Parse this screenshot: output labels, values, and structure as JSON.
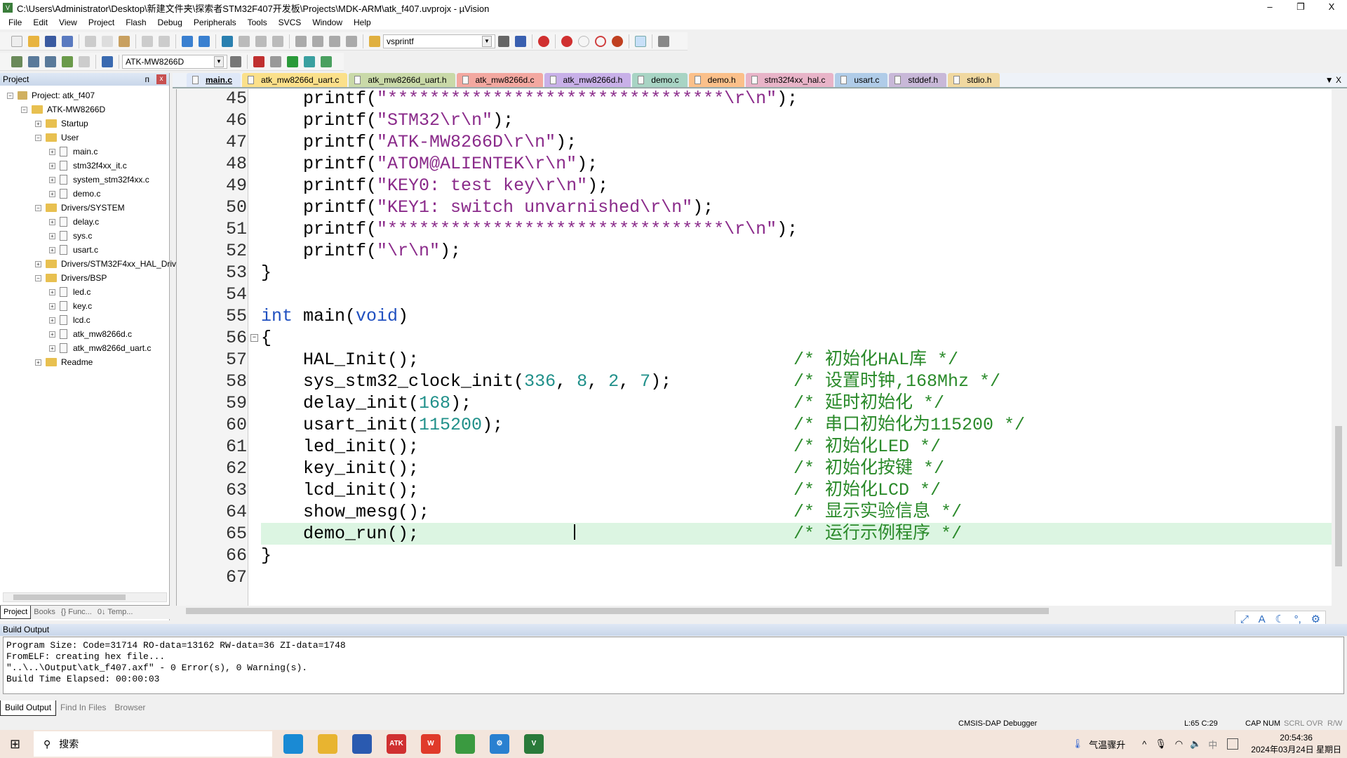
{
  "window": {
    "title": "C:\\Users\\Administrator\\Desktop\\新建文件夹\\探索者STM32F407开发板\\Projects\\MDK-ARM\\atk_f407.uvprojx - µVision",
    "minimize": "–",
    "restore": "❐",
    "close": "X"
  },
  "menu": [
    "File",
    "Edit",
    "View",
    "Project",
    "Flash",
    "Debug",
    "Peripherals",
    "Tools",
    "SVCS",
    "Window",
    "Help"
  ],
  "toolbar": {
    "find_combo": "vsprintf",
    "target_combo": "ATK-MW8266D"
  },
  "project_panel": {
    "title": "Project",
    "pin": "ᴨ",
    "close": "x",
    "tree": [
      {
        "label": "Project: atk_f407",
        "level": 0,
        "type": "root",
        "exp": "−"
      },
      {
        "label": "ATK-MW8266D",
        "level": 1,
        "type": "folder",
        "exp": "−"
      },
      {
        "label": "Startup",
        "level": 2,
        "type": "folder",
        "exp": "+"
      },
      {
        "label": "User",
        "level": 2,
        "type": "folder",
        "exp": "−"
      },
      {
        "label": "main.c",
        "level": 3,
        "type": "file",
        "exp": "+"
      },
      {
        "label": "stm32f4xx_it.c",
        "level": 3,
        "type": "file",
        "exp": "+"
      },
      {
        "label": "system_stm32f4xx.c",
        "level": 3,
        "type": "file",
        "exp": "+"
      },
      {
        "label": "demo.c",
        "level": 3,
        "type": "file",
        "exp": "+"
      },
      {
        "label": "Drivers/SYSTEM",
        "level": 2,
        "type": "folder",
        "exp": "−"
      },
      {
        "label": "delay.c",
        "level": 3,
        "type": "file",
        "exp": "+"
      },
      {
        "label": "sys.c",
        "level": 3,
        "type": "file",
        "exp": "+"
      },
      {
        "label": "usart.c",
        "level": 3,
        "type": "file",
        "exp": "+"
      },
      {
        "label": "Drivers/STM32F4xx_HAL_Driver",
        "level": 2,
        "type": "folder",
        "exp": "+"
      },
      {
        "label": "Drivers/BSP",
        "level": 2,
        "type": "folder",
        "exp": "−"
      },
      {
        "label": "led.c",
        "level": 3,
        "type": "file",
        "exp": "+"
      },
      {
        "label": "key.c",
        "level": 3,
        "type": "file",
        "exp": "+"
      },
      {
        "label": "lcd.c",
        "level": 3,
        "type": "file",
        "exp": "+"
      },
      {
        "label": "atk_mw8266d.c",
        "level": 3,
        "type": "file",
        "exp": "+"
      },
      {
        "label": "atk_mw8266d_uart.c",
        "level": 3,
        "type": "file",
        "exp": "+"
      },
      {
        "label": "Readme",
        "level": 2,
        "type": "folder",
        "exp": "+"
      }
    ],
    "tabs": [
      "Project",
      "Books",
      "{} Func...",
      "0↓ Temp..."
    ]
  },
  "editor_tabs": [
    {
      "label": "main.c",
      "color": "#dfe8f8",
      "active": true
    },
    {
      "label": "atk_mw8266d_uart.c",
      "color": "#fbe08a"
    },
    {
      "label": "atk_mw8266d_uart.h",
      "color": "#c9d9a8"
    },
    {
      "label": "atk_mw8266d.c",
      "color": "#f3a8a0"
    },
    {
      "label": "atk_mw8266d.h",
      "color": "#c8b0e8"
    },
    {
      "label": "demo.c",
      "color": "#a8d4c4"
    },
    {
      "label": "demo.h",
      "color": "#fbc08a"
    },
    {
      "label": "stm32f4xx_hal.c",
      "color": "#e8b4c8"
    },
    {
      "label": "usart.c",
      "color": "#b0cce8"
    },
    {
      "label": "stddef.h",
      "color": "#c8b8d8"
    },
    {
      "label": "stdio.h",
      "color": "#f0d8a0"
    }
  ],
  "tabs_menu": "▼ X",
  "code": [
    {
      "n": "45",
      "t": [
        [
          "",
          "    printf("
        ],
        [
          "str",
          "\"********************************\\r\\n\""
        ],
        [
          "",
          ");"
        ]
      ]
    },
    {
      "n": "46",
      "t": [
        [
          "",
          "    printf("
        ],
        [
          "str",
          "\"STM32\\r\\n\""
        ],
        [
          "",
          ");"
        ]
      ]
    },
    {
      "n": "47",
      "t": [
        [
          "",
          "    printf("
        ],
        [
          "str",
          "\"ATK-MW8266D\\r\\n\""
        ],
        [
          "",
          ");"
        ]
      ]
    },
    {
      "n": "48",
      "t": [
        [
          "",
          "    printf("
        ],
        [
          "str",
          "\"ATOM@ALIENTEK\\r\\n\""
        ],
        [
          "",
          ");"
        ]
      ]
    },
    {
      "n": "49",
      "t": [
        [
          "",
          "    printf("
        ],
        [
          "str",
          "\"KEY0: test key\\r\\n\""
        ],
        [
          "",
          ");"
        ]
      ]
    },
    {
      "n": "50",
      "t": [
        [
          "",
          "    printf("
        ],
        [
          "str",
          "\"KEY1: switch unvarnished\\r\\n\""
        ],
        [
          "",
          ");"
        ]
      ]
    },
    {
      "n": "51",
      "t": [
        [
          "",
          "    printf("
        ],
        [
          "str",
          "\"********************************\\r\\n\""
        ],
        [
          "",
          ");"
        ]
      ]
    },
    {
      "n": "52",
      "t": [
        [
          "",
          "    printf("
        ],
        [
          "str",
          "\"\\r\\n\""
        ],
        [
          "",
          ");"
        ]
      ]
    },
    {
      "n": "53",
      "t": [
        [
          "",
          "}"
        ]
      ]
    },
    {
      "n": "54",
      "t": []
    },
    {
      "n": "55",
      "t": [
        [
          "kw",
          "int"
        ],
        [
          "",
          " main("
        ],
        [
          "kw",
          "void"
        ],
        [
          "",
          ")"
        ]
      ]
    },
    {
      "n": "56",
      "t": [
        [
          "",
          "{"
        ]
      ],
      "fold": "−"
    },
    {
      "n": "57",
      "t": [
        [
          "",
          "    HAL_Init();"
        ]
      ],
      "c": "/* 初始化HAL库 */"
    },
    {
      "n": "58",
      "t": [
        [
          "",
          "    sys_stm32_clock_init("
        ],
        [
          "num",
          "336"
        ],
        [
          "",
          ", "
        ],
        [
          "num",
          "8"
        ],
        [
          "",
          ", "
        ],
        [
          "num",
          "2"
        ],
        [
          "",
          ", "
        ],
        [
          "num",
          "7"
        ],
        [
          "",
          ");"
        ]
      ],
      "c": "/* 设置时钟,168Mhz */"
    },
    {
      "n": "59",
      "t": [
        [
          "",
          "    delay_init("
        ],
        [
          "num",
          "168"
        ],
        [
          "",
          ");"
        ]
      ],
      "c": "/* 延时初始化 */"
    },
    {
      "n": "60",
      "t": [
        [
          "",
          "    usart_init("
        ],
        [
          "num",
          "115200"
        ],
        [
          "",
          ");"
        ]
      ],
      "c": "/* 串口初始化为115200 */"
    },
    {
      "n": "61",
      "t": [
        [
          "",
          "    led_init();"
        ]
      ],
      "c": "/* 初始化LED */"
    },
    {
      "n": "62",
      "t": [
        [
          "",
          "    key_init();"
        ]
      ],
      "c": "/* 初始化按键 */"
    },
    {
      "n": "63",
      "t": [
        [
          "",
          "    lcd_init();"
        ]
      ],
      "c": "/* 初始化LCD */"
    },
    {
      "n": "64",
      "t": [
        [
          "",
          "    show_mesg();"
        ]
      ],
      "c": "/* 显示实验信息 */"
    },
    {
      "n": "65",
      "t": [
        [
          "",
          "    demo_run();"
        ]
      ],
      "c": "/* 运行示例程序 */",
      "current": true
    },
    {
      "n": "66",
      "t": [
        [
          "",
          "}"
        ]
      ]
    },
    {
      "n": "67",
      "t": []
    }
  ],
  "build_output": {
    "title": "Build Output",
    "lines": [
      "Program Size: Code=31714 RO-data=13162 RW-data=36 ZI-data=1748",
      "FromELF: creating hex file...",
      "\"..\\..\\Output\\atk_f407.axf\" - 0 Error(s), 0 Warning(s).",
      "Build Time Elapsed:  00:00:03"
    ],
    "tabs": [
      "Build Output",
      "Find In Files",
      "Browser"
    ]
  },
  "status": {
    "debugger": "CMSIS-DAP Debugger",
    "position": "L:65 C:29",
    "cap": "CAP",
    "num": "NUM",
    "scrl": "SCRL",
    "ovr": "OVR",
    "rw": "R/W"
  },
  "taskbar": {
    "search_placeholder": "搜索",
    "weather": "气温骤升",
    "ime": "中",
    "time": "20:54:36",
    "date": "2024年03月24日 星期日",
    "apps": [
      {
        "name": "edge",
        "color": "#1a8ad4"
      },
      {
        "name": "file-explorer",
        "color": "#e8b430"
      },
      {
        "name": "app-bird",
        "color": "#2a5ab0"
      },
      {
        "name": "atk-xcom",
        "color": "#d03030",
        "label": "ATK"
      },
      {
        "name": "wps",
        "color": "#e03a2a",
        "label": "W"
      },
      {
        "name": "chrome",
        "color": "#3a9a40"
      },
      {
        "name": "settings",
        "color": "#2a80d0",
        "label": "⚙"
      },
      {
        "name": "keil-uvision",
        "color": "#2a7a3a",
        "label": "V"
      }
    ]
  }
}
